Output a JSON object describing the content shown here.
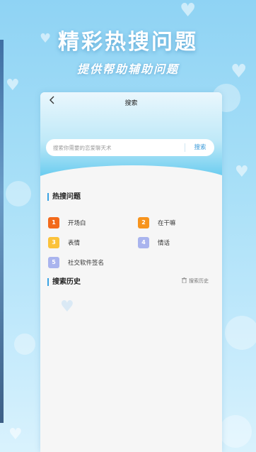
{
  "promo": {
    "headline": "精彩热搜问题",
    "subline": "提供帮助辅助问题"
  },
  "nav": {
    "title": "搜索",
    "back_icon": "chevron-left-icon"
  },
  "search": {
    "placeholder": "搜索你需要的恋爱聊天术",
    "value": "",
    "button_label": "搜索"
  },
  "hot_section": {
    "title": "热搜问题",
    "items": [
      {
        "rank": "1",
        "label": "开场白",
        "color": "#f26a1b"
      },
      {
        "rank": "2",
        "label": "在干嘛",
        "color": "#f7941d"
      },
      {
        "rank": "3",
        "label": "表情",
        "color": "#fbc23b"
      },
      {
        "rank": "4",
        "label": "情话",
        "color": "#a9b4ee"
      },
      {
        "rank": "5",
        "label": "社交软件签名",
        "color": "#a9b4ee"
      }
    ]
  },
  "history_section": {
    "title": "搜索历史",
    "clear_label": "搜索历史",
    "clear_icon": "trash-icon"
  },
  "colors": {
    "accent": "#3aa3e3",
    "background_top": "#8fd3f4"
  }
}
